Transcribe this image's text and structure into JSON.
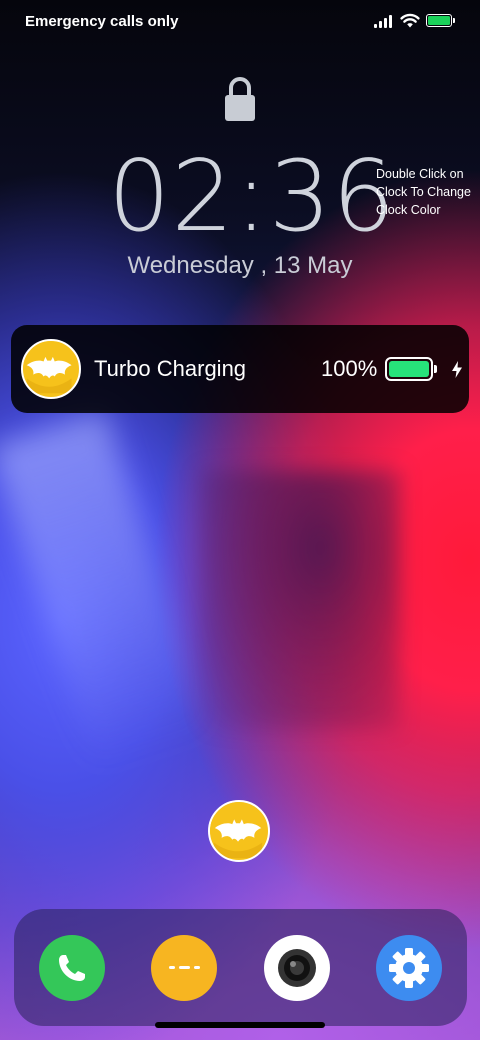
{
  "status_bar": {
    "carrier_text": "Emergency calls only",
    "signal_icon": "signal-icon",
    "wifi_icon": "wifi-icon",
    "battery_icon": "battery-icon",
    "battery_color": "#1bd15a"
  },
  "lock_screen": {
    "lock_icon": "lock-icon",
    "time": "02:36",
    "clock_hint": "Double Click on Clock To Change Clock Color",
    "date": "Wednesday , 13 May"
  },
  "charging_card": {
    "app_icon": "bat-logo-icon",
    "label": "Turbo Charging",
    "percent": "100%",
    "battery_level": 1.0,
    "battery_color": "#27e27a",
    "bolt_icon": "bolt-icon"
  },
  "floating_button": {
    "icon": "bat-logo-icon",
    "color": "#f6c21b"
  },
  "dock": {
    "apps": [
      {
        "name": "phone",
        "icon": "phone-icon",
        "color": "#34c759"
      },
      {
        "name": "messages",
        "icon": "message-icon",
        "color": "#f7b521"
      },
      {
        "name": "camera",
        "icon": "camera-icon",
        "color": "#ffffff"
      },
      {
        "name": "settings",
        "icon": "gear-icon",
        "color": "#3d8cf0"
      }
    ]
  }
}
